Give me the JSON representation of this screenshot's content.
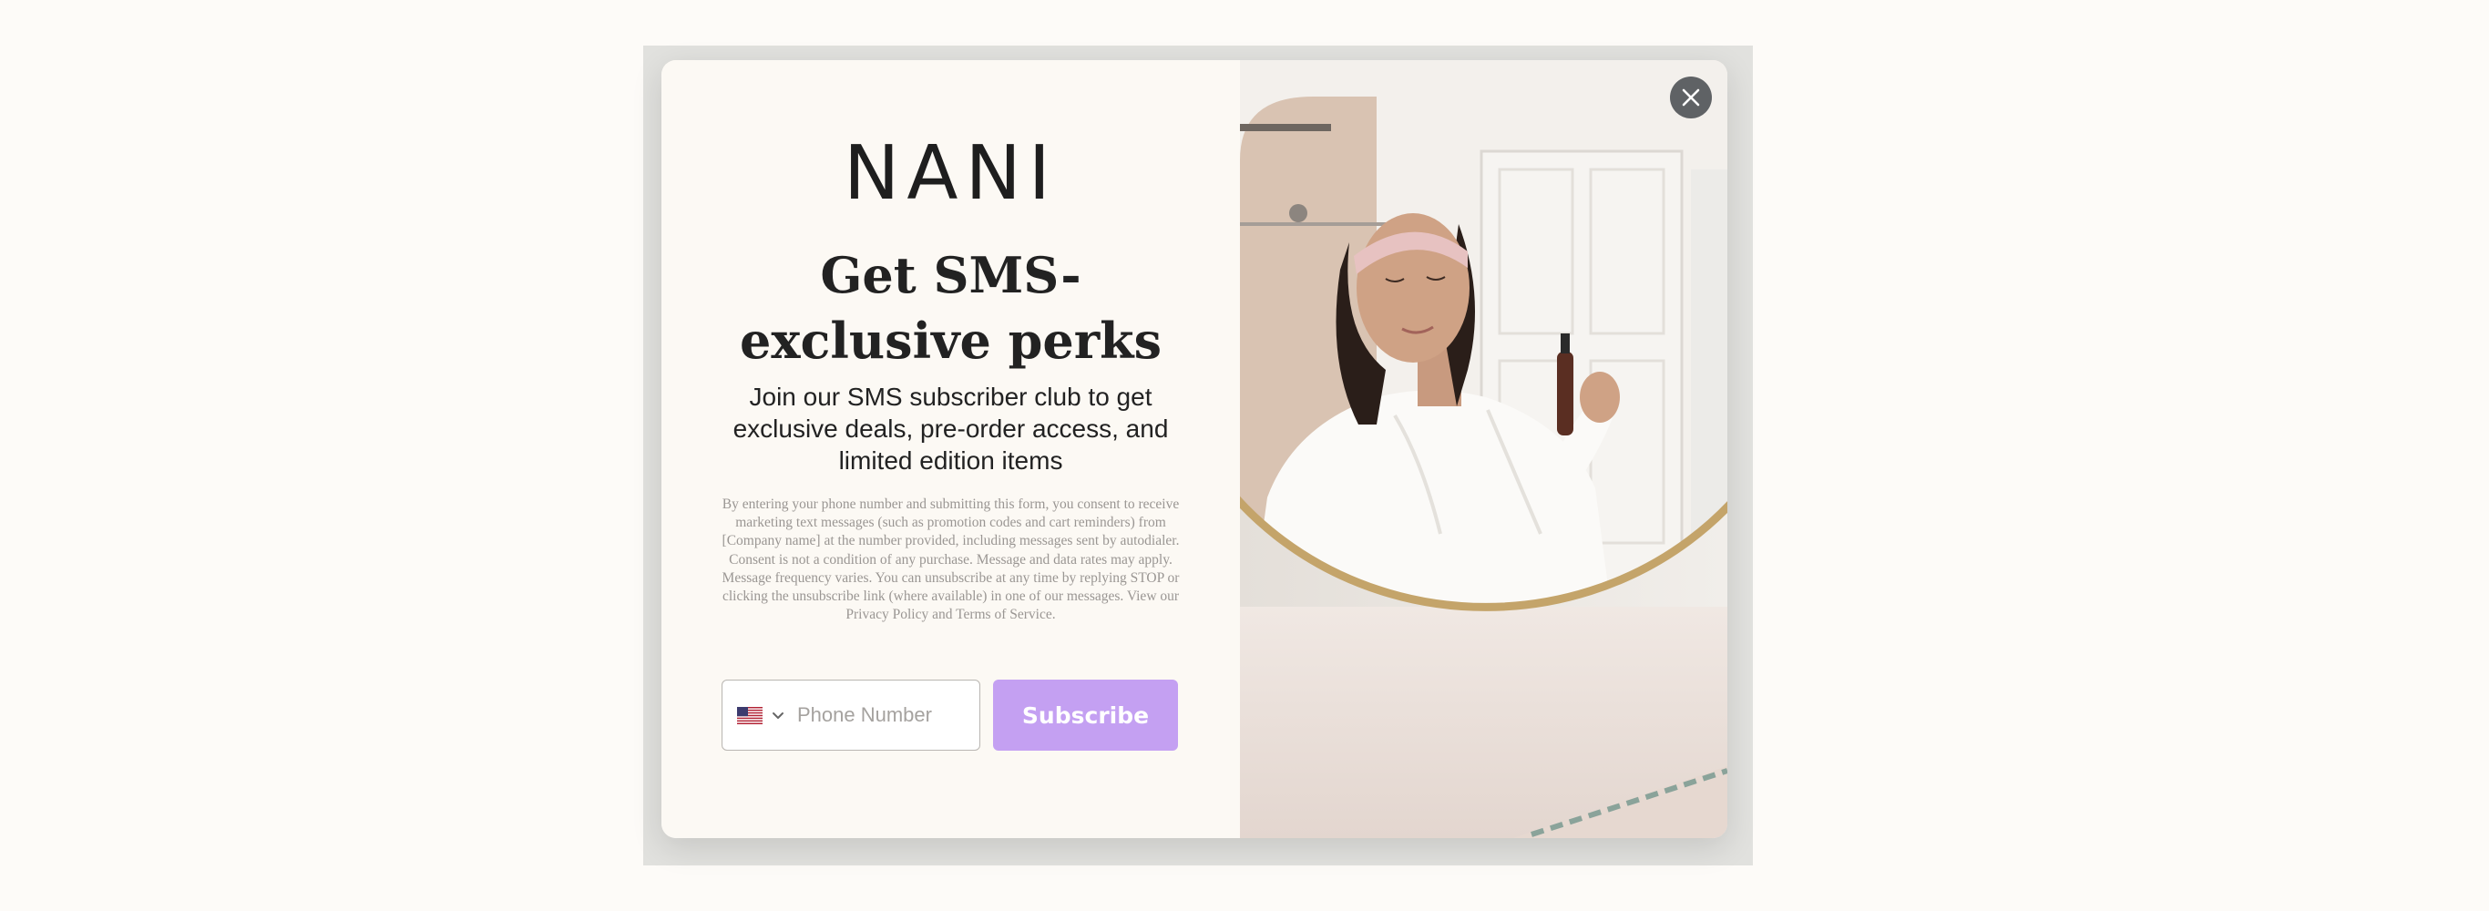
{
  "brand": {
    "logo_text": "NANI"
  },
  "popup": {
    "headline": "Get SMS-exclusive perks",
    "subtext": "Join our SMS subscriber club to get exclusive deals, pre-order access, and limited edition items",
    "legal": "By entering your phone number and submitting this form, you consent to receive marketing text messages (such as promotion codes and cart reminders) from [Company name] at the number provided, including messages sent by autodialer. Consent is not a condition of any purchase. Message and data rates may apply. Message frequency varies. You can unsubscribe at any time by replying STOP or clicking the unsubscribe link (where available) in one of our messages. View our Privacy Policy and Terms of Service."
  },
  "form": {
    "country_icon": "us-flag-icon",
    "phone_placeholder": "Phone Number",
    "phone_value": "",
    "subscribe_label": "Subscribe"
  },
  "colors": {
    "panel_background": "#fcf9f4",
    "button_accent": "#c4a0f2",
    "close_button": "#5f6265",
    "text_primary": "#222222"
  },
  "icons": {
    "close": "close-icon",
    "chevron": "chevron-down-icon"
  }
}
